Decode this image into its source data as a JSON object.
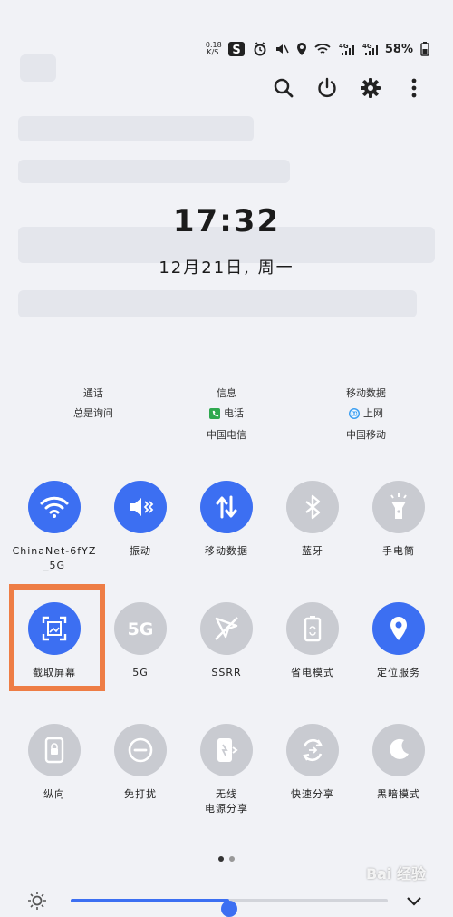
{
  "status_bar": {
    "net_speed_value": "0.18",
    "net_speed_unit": "K/S",
    "battery": "58%",
    "icons": [
      "app-s-icon",
      "alarm-icon",
      "mute-icon",
      "location-icon",
      "wifi-icon",
      "signal-4g-icon",
      "signal-4g-icon",
      "battery-icon"
    ]
  },
  "top_actions": [
    "search-icon",
    "power-icon",
    "gear-icon",
    "more-vertical-icon"
  ],
  "clock": {
    "time": "17:32",
    "date": "12月21日, 周一"
  },
  "info": {
    "call": {
      "title": "通话",
      "value": "总是询问"
    },
    "messages": {
      "title": "信息",
      "app": "电话",
      "carrier": "中国电信"
    },
    "mobile_data": {
      "title": "移动数据",
      "app": "上网",
      "carrier": "中国移动"
    }
  },
  "tiles": {
    "row1": [
      {
        "label": "ChinaNet-6fYZ_5G",
        "state": "on",
        "icon": "wifi-icon"
      },
      {
        "label": "振动",
        "state": "on",
        "icon": "vibrate-icon"
      },
      {
        "label": "移动数据",
        "state": "on",
        "icon": "data-arrows-icon"
      },
      {
        "label": "蓝牙",
        "state": "off",
        "icon": "bluetooth-icon"
      },
      {
        "label": "手电筒",
        "state": "off",
        "icon": "flashlight-icon"
      }
    ],
    "row2": [
      {
        "label": "截取屏幕",
        "state": "on",
        "icon": "screenshot-icon"
      },
      {
        "label": "5G",
        "state": "off",
        "icon": "5g-icon"
      },
      {
        "label": "SSRR",
        "state": "off",
        "icon": "ssrr-icon"
      },
      {
        "label": "省电模式",
        "state": "off",
        "icon": "battery-saver-icon"
      },
      {
        "label": "定位服务",
        "state": "on",
        "icon": "location-pin-icon"
      }
    ],
    "row3": [
      {
        "label": "纵向",
        "state": "off",
        "icon": "portrait-lock-icon"
      },
      {
        "label": "免打扰",
        "state": "off",
        "icon": "dnd-icon"
      },
      {
        "label": "无线电源分享",
        "label_line1": "无线",
        "label_line2": "电源分享",
        "state": "off",
        "icon": "wireless-powershare-icon"
      },
      {
        "label": "快速分享",
        "state": "off",
        "icon": "quick-share-icon"
      },
      {
        "label": "黑暗模式",
        "state": "off",
        "icon": "dark-mode-icon"
      }
    ]
  },
  "page_indicator": {
    "pages": 2,
    "current": 1
  },
  "brightness": {
    "level": 0.5,
    "icon": "sun-icon"
  },
  "colors": {
    "accent": "#3c6ff2",
    "off": "#c9cbd1",
    "highlight": "#ee7d45"
  },
  "watermark": "Bai 经验"
}
